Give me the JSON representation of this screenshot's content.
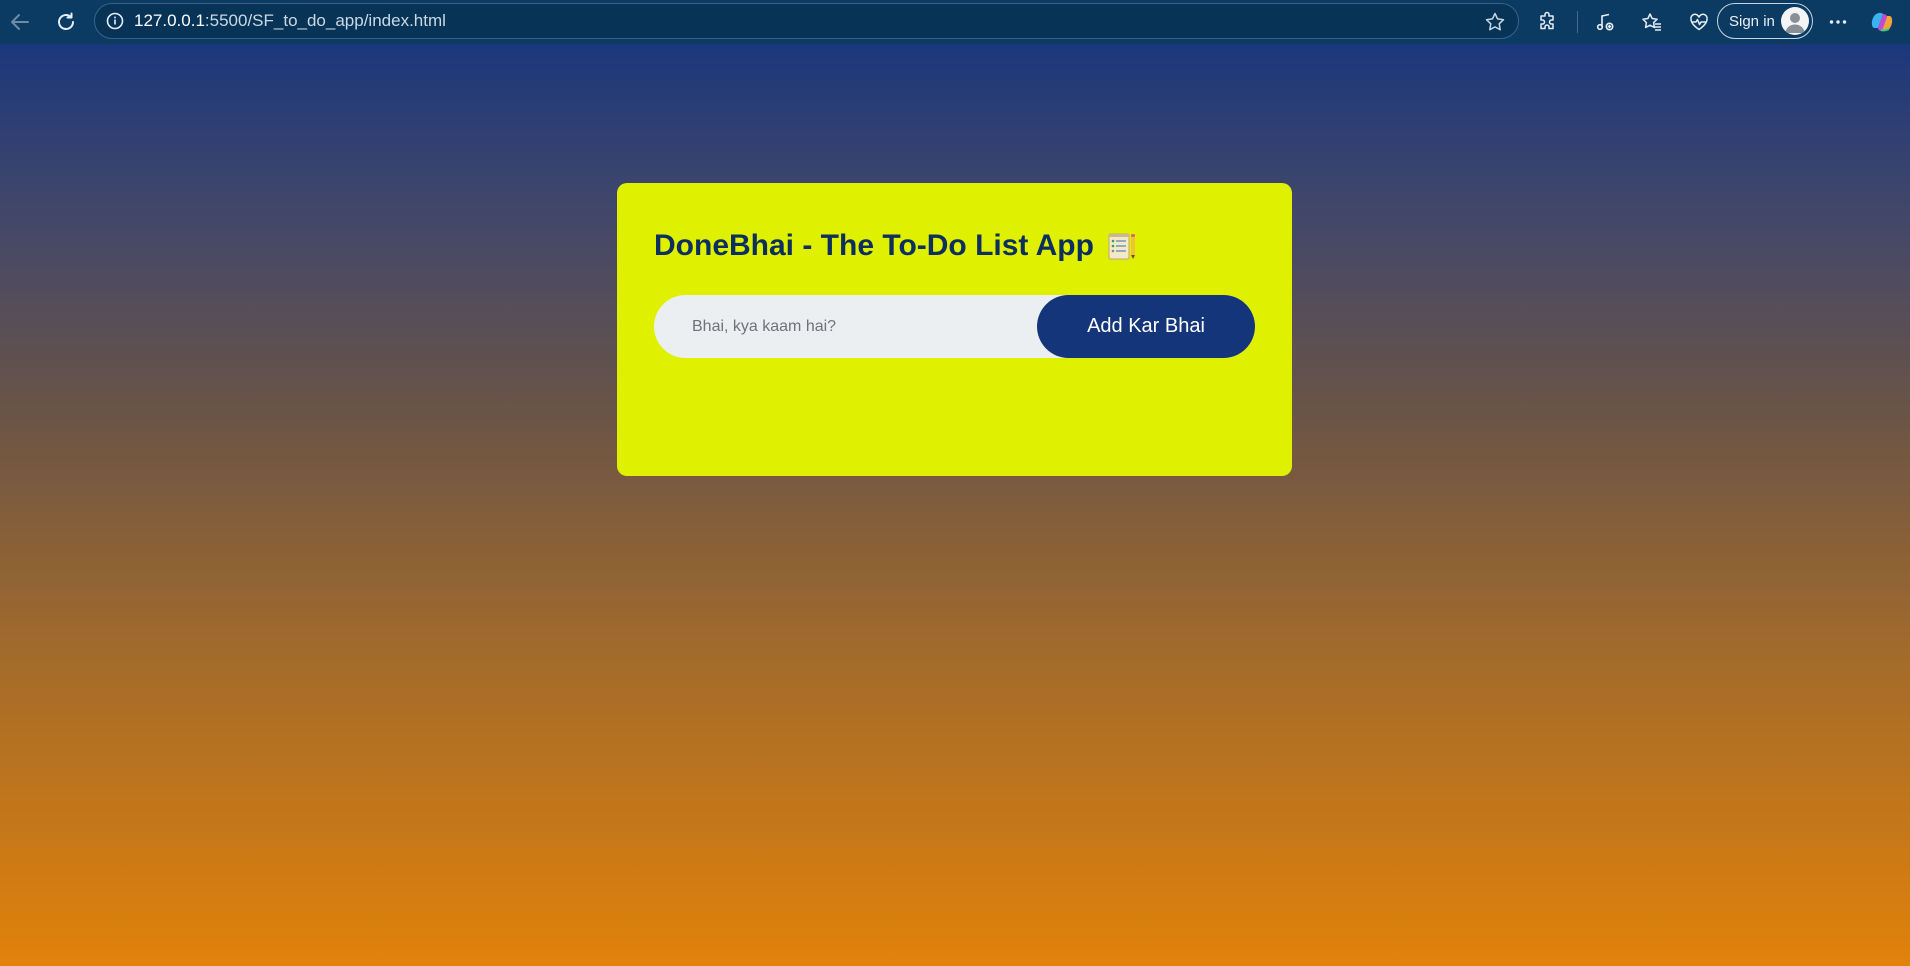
{
  "browser": {
    "url_host": "127.0.0.1",
    "url_path": ":5500/SF_to_do_app/index.html",
    "signin_label": "Sign in",
    "colors": {
      "toolbar_bg": "#0b3b63",
      "address_bg": "#073456"
    }
  },
  "app": {
    "title": "DoneBhai - The To-Do List App",
    "title_emoji": "notepad-icon",
    "input": {
      "placeholder": "Bhai, kya kaam hai?",
      "value": ""
    },
    "add_button_label": "Add Kar Bhai",
    "colors": {
      "card_bg": "#dff000",
      "title": "#0d2f5e",
      "button_bg": "#15357a",
      "bg_top": "#1b377c",
      "bg_bottom": "#e2820a"
    }
  }
}
